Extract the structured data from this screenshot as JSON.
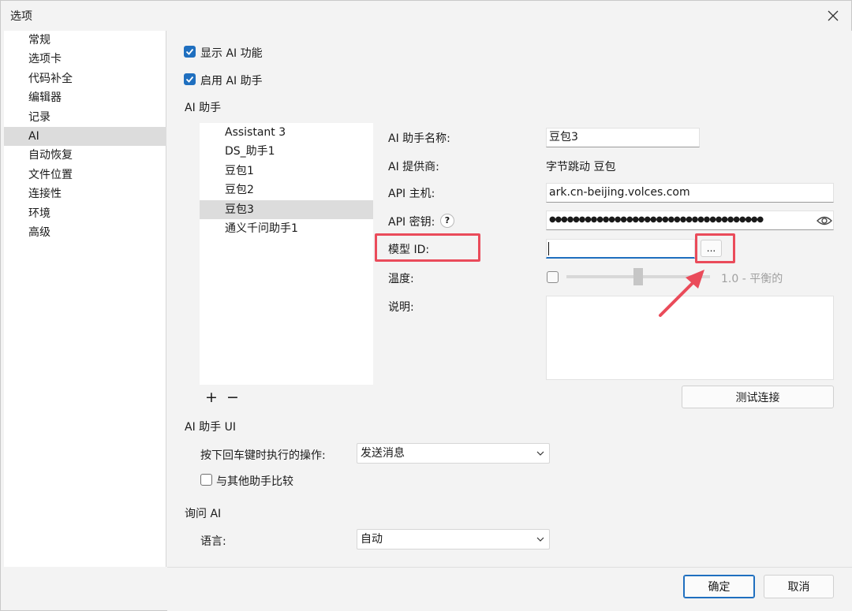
{
  "window": {
    "title": "选项"
  },
  "sidebar": {
    "items": [
      {
        "label": "常规"
      },
      {
        "label": "选项卡"
      },
      {
        "label": "代码补全"
      },
      {
        "label": "编辑器"
      },
      {
        "label": "记录"
      },
      {
        "label": "AI",
        "selected": true
      },
      {
        "label": "自动恢复"
      },
      {
        "label": "文件位置"
      },
      {
        "label": "连接性"
      },
      {
        "label": "环境"
      },
      {
        "label": "高级"
      }
    ]
  },
  "ai": {
    "show_ai_label": "显示 AI 功能",
    "enable_assistant_label": "启用 AI 助手",
    "section_title": "AI 助手",
    "assistants": [
      {
        "label": "Assistant 3"
      },
      {
        "label": "DS_助手1"
      },
      {
        "label": "豆包1"
      },
      {
        "label": "豆包2"
      },
      {
        "label": "豆包3",
        "selected": true
      },
      {
        "label": "通义千问助手1"
      }
    ],
    "add_symbol": "+",
    "remove_symbol": "−",
    "form": {
      "name_label": "AI 助手名称:",
      "name_value": "豆包3",
      "provider_label": "AI 提供商:",
      "provider_value": "字节跳动 豆包",
      "host_label": "API 主机:",
      "host_value": "ark.cn-beijing.volces.com",
      "key_label": "API 密钥:",
      "key_help": "?",
      "key_value": "●●●●●●●●●●●●●●●●●●●●●●●●●●●●●●●●●●●●",
      "model_label": "模型 ID:",
      "model_value": "",
      "model_browse": "...",
      "temperature_label": "温度:",
      "temperature_value": "1.0 - 平衡的",
      "temperature_level": 0.5,
      "desc_label": "说明:",
      "desc_value": "",
      "test_button": "测试连接"
    },
    "ui_section_title": "AI 助手 UI",
    "enter_action_label": "按下回车键时执行的操作:",
    "enter_action_value": "发送消息",
    "compare_label": "与其他助手比较",
    "ask_section_title": "询问 AI",
    "language_label": "语言:",
    "language_value": "自动"
  },
  "footer": {
    "ok_label": "确定",
    "cancel_label": "取消"
  },
  "colors": {
    "accent": "#1f6fbf",
    "highlight": "#ea4b5a"
  }
}
